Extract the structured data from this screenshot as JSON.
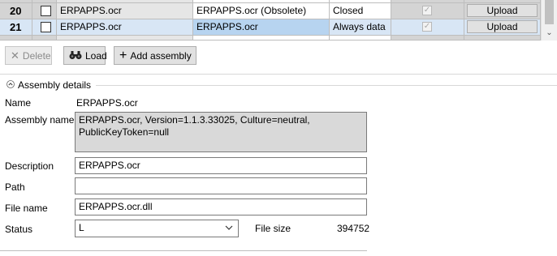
{
  "grid": {
    "rows": [
      {
        "num": "",
        "name": "",
        "description": "",
        "status": "",
        "upload": ""
      },
      {
        "num": "20",
        "name": "ERPAPPS.ocr",
        "description": "ERPAPPS.ocr (Obsolete)",
        "status": "Closed",
        "upload": "Upload"
      },
      {
        "num": "21",
        "name": "ERPAPPS.ocr",
        "description": "ERPAPPS.ocr",
        "status": "Always data",
        "upload": "Upload"
      },
      {
        "num": "",
        "name": "",
        "description": "",
        "status": "",
        "upload": ""
      }
    ]
  },
  "toolbar": {
    "delete_label": "Delete",
    "load_label": "Load",
    "add_label": "Add assembly"
  },
  "details": {
    "section_title": "Assembly details",
    "name_label": "Name",
    "name_value": "ERPAPPS.ocr",
    "assembly_name_label": "Assembly name",
    "assembly_name_value": "ERPAPPS.ocr, Version=1.1.3.33025, Culture=neutral, PublicKeyToken=null",
    "description_label": "Description",
    "description_value": "ERPAPPS.ocr",
    "path_label": "Path",
    "path_value": "",
    "file_name_label": "File name",
    "file_name_value": "ERPAPPS.ocr.dll",
    "status_label": "Status",
    "status_value": "L",
    "file_size_label": "File size",
    "file_size_value": "394752"
  },
  "icons": {
    "delete": "close-icon",
    "load": "binoculars-icon",
    "add": "plus-icon",
    "section": "chevron-up-icon",
    "dropdown": "chevron-down-icon"
  },
  "colors": {
    "selected_cell": "#b7d4f0",
    "selected_row": "#d8e6f5",
    "readonly_field": "#d9d9d9"
  }
}
